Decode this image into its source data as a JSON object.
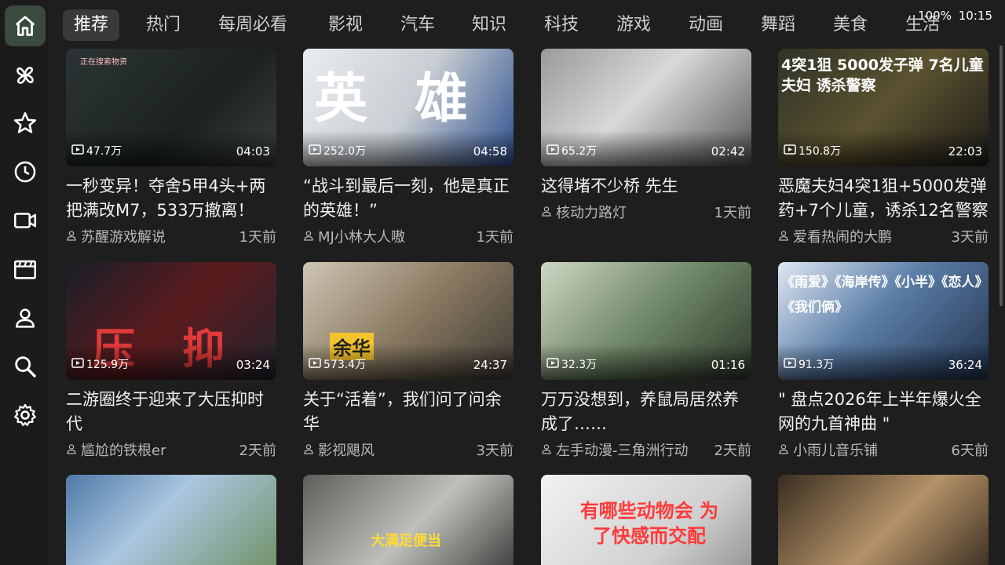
{
  "sidebar": {
    "items": [
      {
        "icon": "home-icon",
        "active": true
      },
      {
        "icon": "pinwheel-icon"
      },
      {
        "icon": "star-icon"
      },
      {
        "icon": "history-icon"
      },
      {
        "icon": "video-icon"
      },
      {
        "icon": "clapperboard-icon"
      },
      {
        "icon": "user-icon"
      },
      {
        "icon": "search-icon"
      },
      {
        "icon": "gear-icon"
      }
    ]
  },
  "tabs": [
    "推荐",
    "热门",
    "每周必看",
    "影视",
    "汽车",
    "知识",
    "科技",
    "游戏",
    "动画",
    "舞蹈",
    "美食",
    "生活"
  ],
  "active_tab": 0,
  "status": {
    "battery": "100%",
    "time": "10:15"
  },
  "videos": [
    {
      "views": "47.7万",
      "duration": "04:03",
      "title": "一秒变异！夺舍5甲4头+两把满改M7，533万撤离！",
      "author": "苏醒游戏解说",
      "age": "1天前",
      "overlay": "正在搜索物资"
    },
    {
      "views": "252.0万",
      "duration": "04:58",
      "title": "“战斗到最后一刻，他是真正的英雄！”",
      "author": "MJ小林大人嗷",
      "age": "1天前",
      "overlay": "英雄"
    },
    {
      "views": "65.2万",
      "duration": "02:42",
      "title": "这得堵不少桥 先生",
      "author": "核动力路灯",
      "age": "1天前",
      "overlay": ""
    },
    {
      "views": "150.8万",
      "duration": "22:03",
      "title": "恶魔夫妇4突1狙+5000发弹药+7个儿童，诱杀12名警察",
      "author": "爱看热闹的大鹏",
      "age": "3天前",
      "overlay": "4突1狙 5000发子弹 7名儿童 夫妇 诱杀警察"
    },
    {
      "views": "125.9万",
      "duration": "03:24",
      "title": "二游圈终于迎来了大压抑时代",
      "author": "尴尬的铁根er",
      "age": "2天前",
      "overlay": "压抑"
    },
    {
      "views": "573.4万",
      "duration": "24:37",
      "title": "关于“活着”，我们问了问余华",
      "author": "影视飓风",
      "age": "3天前",
      "overlay": "余华"
    },
    {
      "views": "32.3万",
      "duration": "01:16",
      "title": "万万没想到，养鼠局居然养成了……",
      "author": "左手动漫-三角洲行动",
      "age": "2天前",
      "overlay": ""
    },
    {
      "views": "91.3万",
      "duration": "36:24",
      "title": "\" 盘点2026年上半年爆火全网的九首神曲 \"",
      "author": "小雨儿音乐铺",
      "age": "6天前",
      "overlay": "《雨爱》《海岸传》《小半》《恋人》《我们俩》"
    },
    {
      "views": "",
      "duration": "",
      "title": "",
      "author": "",
      "age": "",
      "overlay": ""
    },
    {
      "views": "",
      "duration": "",
      "title": "",
      "author": "",
      "age": "",
      "overlay": "大满足便当"
    },
    {
      "views": "",
      "duration": "",
      "title": "",
      "author": "",
      "age": "",
      "overlay": "有哪些动物会 为了快感而交配"
    },
    {
      "views": "",
      "duration": "",
      "title": "",
      "author": "",
      "age": "",
      "overlay": ""
    }
  ],
  "colors": {
    "background": "#1e1e1e",
    "active_nav": "#3a4a3c",
    "active_tab": "#3a3a3a"
  }
}
